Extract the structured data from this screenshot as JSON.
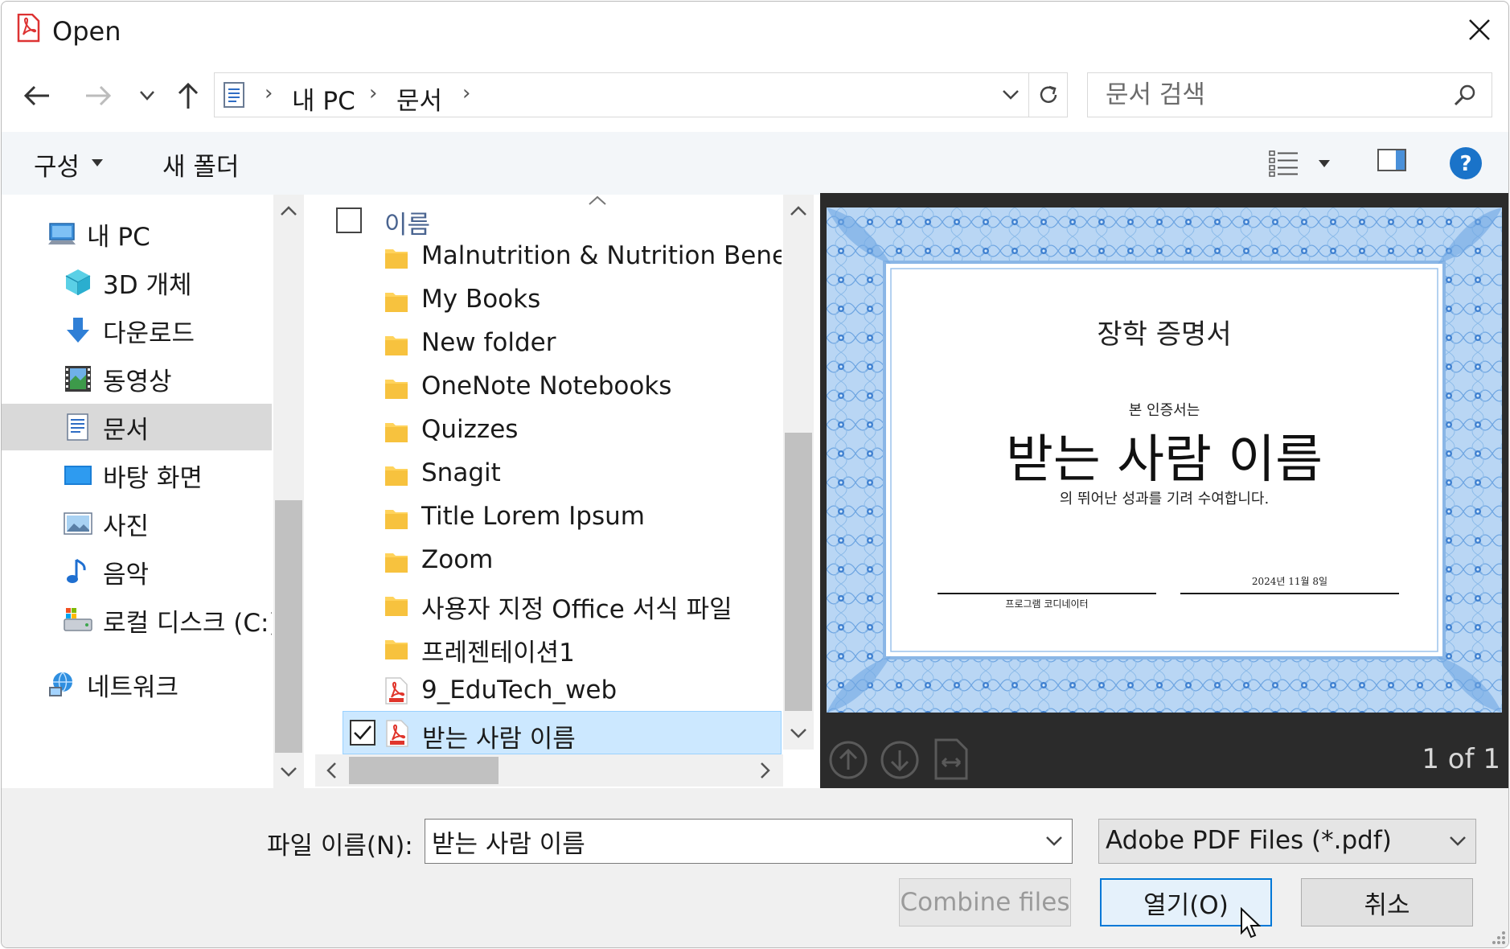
{
  "window": {
    "title": "Open"
  },
  "nav": {
    "breadcrumbs": [
      "내 PC",
      "문서"
    ],
    "search_placeholder": "문서 검색"
  },
  "toolbar": {
    "organize_label": "구성",
    "new_folder_label": "새 폴더"
  },
  "sidebar": {
    "items": [
      {
        "label": "내 PC",
        "icon": "computer-icon"
      },
      {
        "label": "3D 개체",
        "icon": "3d-objects-icon"
      },
      {
        "label": "다운로드",
        "icon": "download-icon"
      },
      {
        "label": "동영상",
        "icon": "video-icon"
      },
      {
        "label": "문서",
        "icon": "documents-icon",
        "selected": true
      },
      {
        "label": "바탕 화면",
        "icon": "desktop-icon"
      },
      {
        "label": "사진",
        "icon": "pictures-icon"
      },
      {
        "label": "음악",
        "icon": "music-icon"
      },
      {
        "label": "로컬 디스크 (C:)",
        "icon": "local-disk-icon"
      },
      {
        "label": "네트워크",
        "icon": "network-icon"
      }
    ]
  },
  "file_list": {
    "header_name": "이름",
    "items": [
      {
        "name": "Malnutrition & Nutrition Benefits",
        "type": "folder"
      },
      {
        "name": "My Books",
        "type": "folder"
      },
      {
        "name": "New folder",
        "type": "folder"
      },
      {
        "name": "OneNote Notebooks",
        "type": "folder"
      },
      {
        "name": "Quizzes",
        "type": "folder"
      },
      {
        "name": "Snagit",
        "type": "folder"
      },
      {
        "name": "Title Lorem Ipsum",
        "type": "folder"
      },
      {
        "name": "Zoom",
        "type": "folder"
      },
      {
        "name": "사용자 지정 Office 서식 파일",
        "type": "folder"
      },
      {
        "name": "프레젠테이션1",
        "type": "folder"
      },
      {
        "name": "9_EduTech_web",
        "type": "pdf"
      },
      {
        "name": "받는 사람 이름",
        "type": "pdf",
        "selected": true
      }
    ]
  },
  "preview": {
    "certificate": {
      "title": "장학 증명서",
      "subtitle": "본 인증서는",
      "recipient": "받는 사람 이름",
      "body": "의 뛰어난 성과를 기려 수여합니다.",
      "date": "2024년 11월 8일",
      "signer": "프로그램 코디네이터"
    },
    "page_indicator": "1 of 1"
  },
  "bottom": {
    "filename_label": "파일 이름(N):",
    "filename_value": "받는 사람 이름",
    "filetype_value": "Adobe PDF Files (*.pdf)",
    "combine_label": "Combine files",
    "open_label": "열기(O)",
    "cancel_label": "취소"
  },
  "colors": {
    "accent": "#0078d7",
    "selection": "#cce8ff",
    "folder": "#ffd35c",
    "pdf": "#e0352b",
    "help": "#1a73c9"
  }
}
